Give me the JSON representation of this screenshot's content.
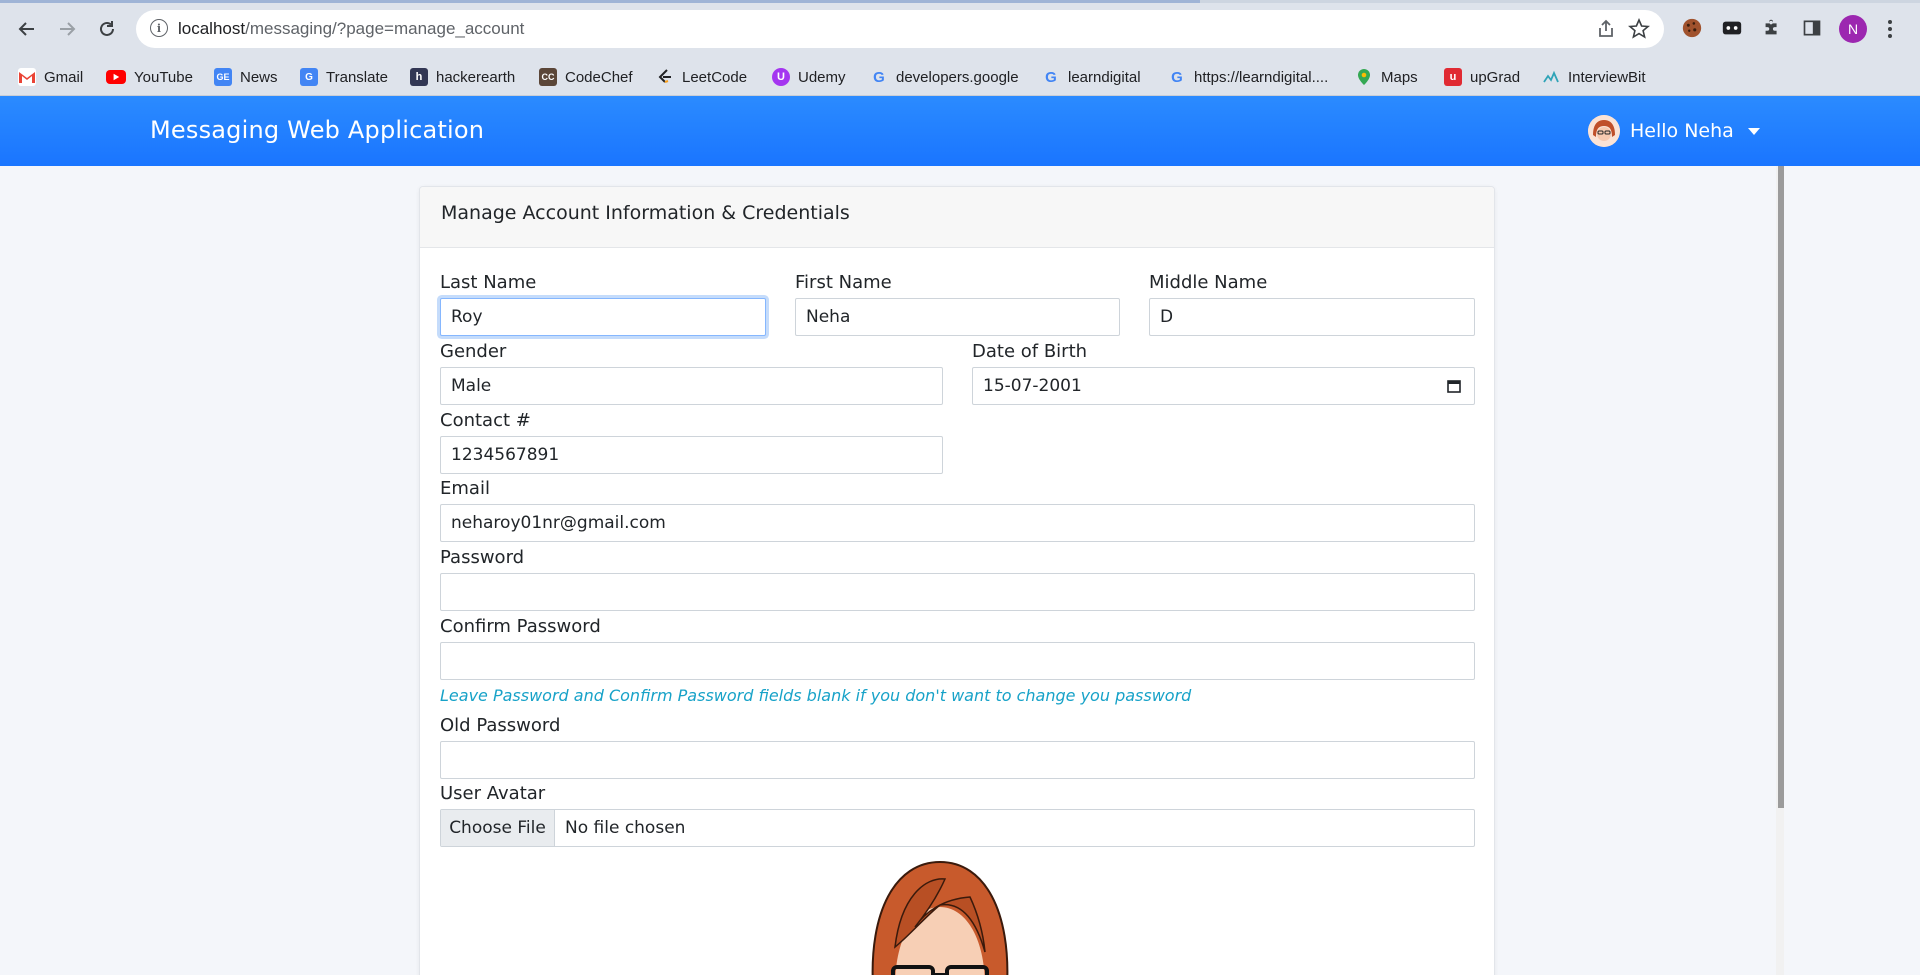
{
  "browser": {
    "url_host": "localhost",
    "url_path": "/messaging/?page=manage_account",
    "profile_initial": "N",
    "bookmarks": [
      {
        "label": "Gmail",
        "icon": "gmail-icon"
      },
      {
        "label": "YouTube",
        "icon": "youtube-icon"
      },
      {
        "label": "News",
        "icon": "google-news-icon"
      },
      {
        "label": "Translate",
        "icon": "google-translate-icon"
      },
      {
        "label": "hackerearth",
        "icon": "hackerearth-icon"
      },
      {
        "label": "CodeChef",
        "icon": "codechef-icon"
      },
      {
        "label": "LeetCode",
        "icon": "leetcode-icon"
      },
      {
        "label": "Udemy",
        "icon": "udemy-icon"
      },
      {
        "label": "developers.google",
        "icon": "google-icon"
      },
      {
        "label": "learndigital",
        "icon": "google-icon"
      },
      {
        "label": "https://learndigital....",
        "icon": "google-icon"
      },
      {
        "label": "Maps",
        "icon": "google-maps-icon"
      },
      {
        "label": "upGrad",
        "icon": "upgrad-icon"
      },
      {
        "label": "InterviewBit",
        "icon": "interviewbit-icon"
      }
    ]
  },
  "app": {
    "title": "Messaging Web Application",
    "greeting": "Hello Neha"
  },
  "form": {
    "header": "Manage Account Information & Credentials",
    "last_name": {
      "label": "Last Name",
      "value": "Roy"
    },
    "first_name": {
      "label": "First Name",
      "value": "Neha"
    },
    "middle_name": {
      "label": "Middle Name",
      "value": "D"
    },
    "gender": {
      "label": "Gender",
      "value": "Male"
    },
    "dob": {
      "label": "Date of Birth",
      "value": "15-07-2001"
    },
    "contact": {
      "label": "Contact #",
      "value": "1234567891"
    },
    "email": {
      "label": "Email",
      "value": "neharoy01nr@gmail.com"
    },
    "password": {
      "label": "Password",
      "value": ""
    },
    "confirm_password": {
      "label": "Confirm Password",
      "value": ""
    },
    "password_hint": "Leave Password and Confirm Password fields blank if you don't want to change you password",
    "old_password": {
      "label": "Old Password",
      "value": ""
    },
    "avatar": {
      "label": "User Avatar",
      "button": "Choose File",
      "status": "No file chosen"
    }
  },
  "colors": {
    "navbar": "#1a75ff",
    "hint": "#17a2c8",
    "profile": "#9c27b0"
  }
}
